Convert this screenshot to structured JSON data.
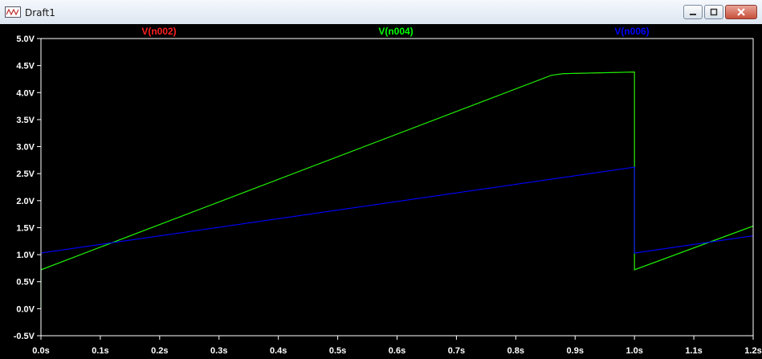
{
  "window": {
    "title": "Draft1",
    "icon": "waveform-app-icon"
  },
  "colors": {
    "red": "#ff2020",
    "green": "#00ff00",
    "blue": "#0000ff",
    "axis": "#ffffff",
    "background": "#000000"
  },
  "chart_data": {
    "type": "line",
    "title": "",
    "xlabel": "",
    "ylabel": "",
    "xlim": [
      0.0,
      1.2
    ],
    "ylim": [
      -0.5,
      5.0
    ],
    "grid": false,
    "legend": "top",
    "x_ticks": [
      "0.0s",
      "0.1s",
      "0.2s",
      "0.3s",
      "0.4s",
      "0.5s",
      "0.6s",
      "0.7s",
      "0.8s",
      "0.9s",
      "1.0s",
      "1.1s",
      "1.2s"
    ],
    "y_ticks": [
      "-0.5V",
      "0.0V",
      "0.5V",
      "1.0V",
      "1.5V",
      "2.0V",
      "2.5V",
      "3.0V",
      "3.5V",
      "4.0V",
      "4.5V",
      "5.0V"
    ],
    "series": [
      {
        "name": "V(n002)",
        "color": "#ff2020",
        "x": [
          0.0,
          0.86,
          0.88,
          1.0,
          1.0,
          1.2
        ],
        "y": [
          0.72,
          4.32,
          4.35,
          4.38,
          0.72,
          1.53
        ]
      },
      {
        "name": "V(n004)",
        "color": "#00ff00",
        "x": [
          0.0,
          0.0,
          0.86,
          0.88,
          1.0,
          1.0,
          1.2
        ],
        "y": [
          0.0,
          0.72,
          4.32,
          4.35,
          4.38,
          0.72,
          1.53
        ]
      },
      {
        "name": "V(n006)",
        "color": "#0000ff",
        "x": [
          0.0,
          1.0,
          1.0,
          1.2
        ],
        "y": [
          1.03,
          2.62,
          1.03,
          1.35
        ]
      }
    ]
  }
}
